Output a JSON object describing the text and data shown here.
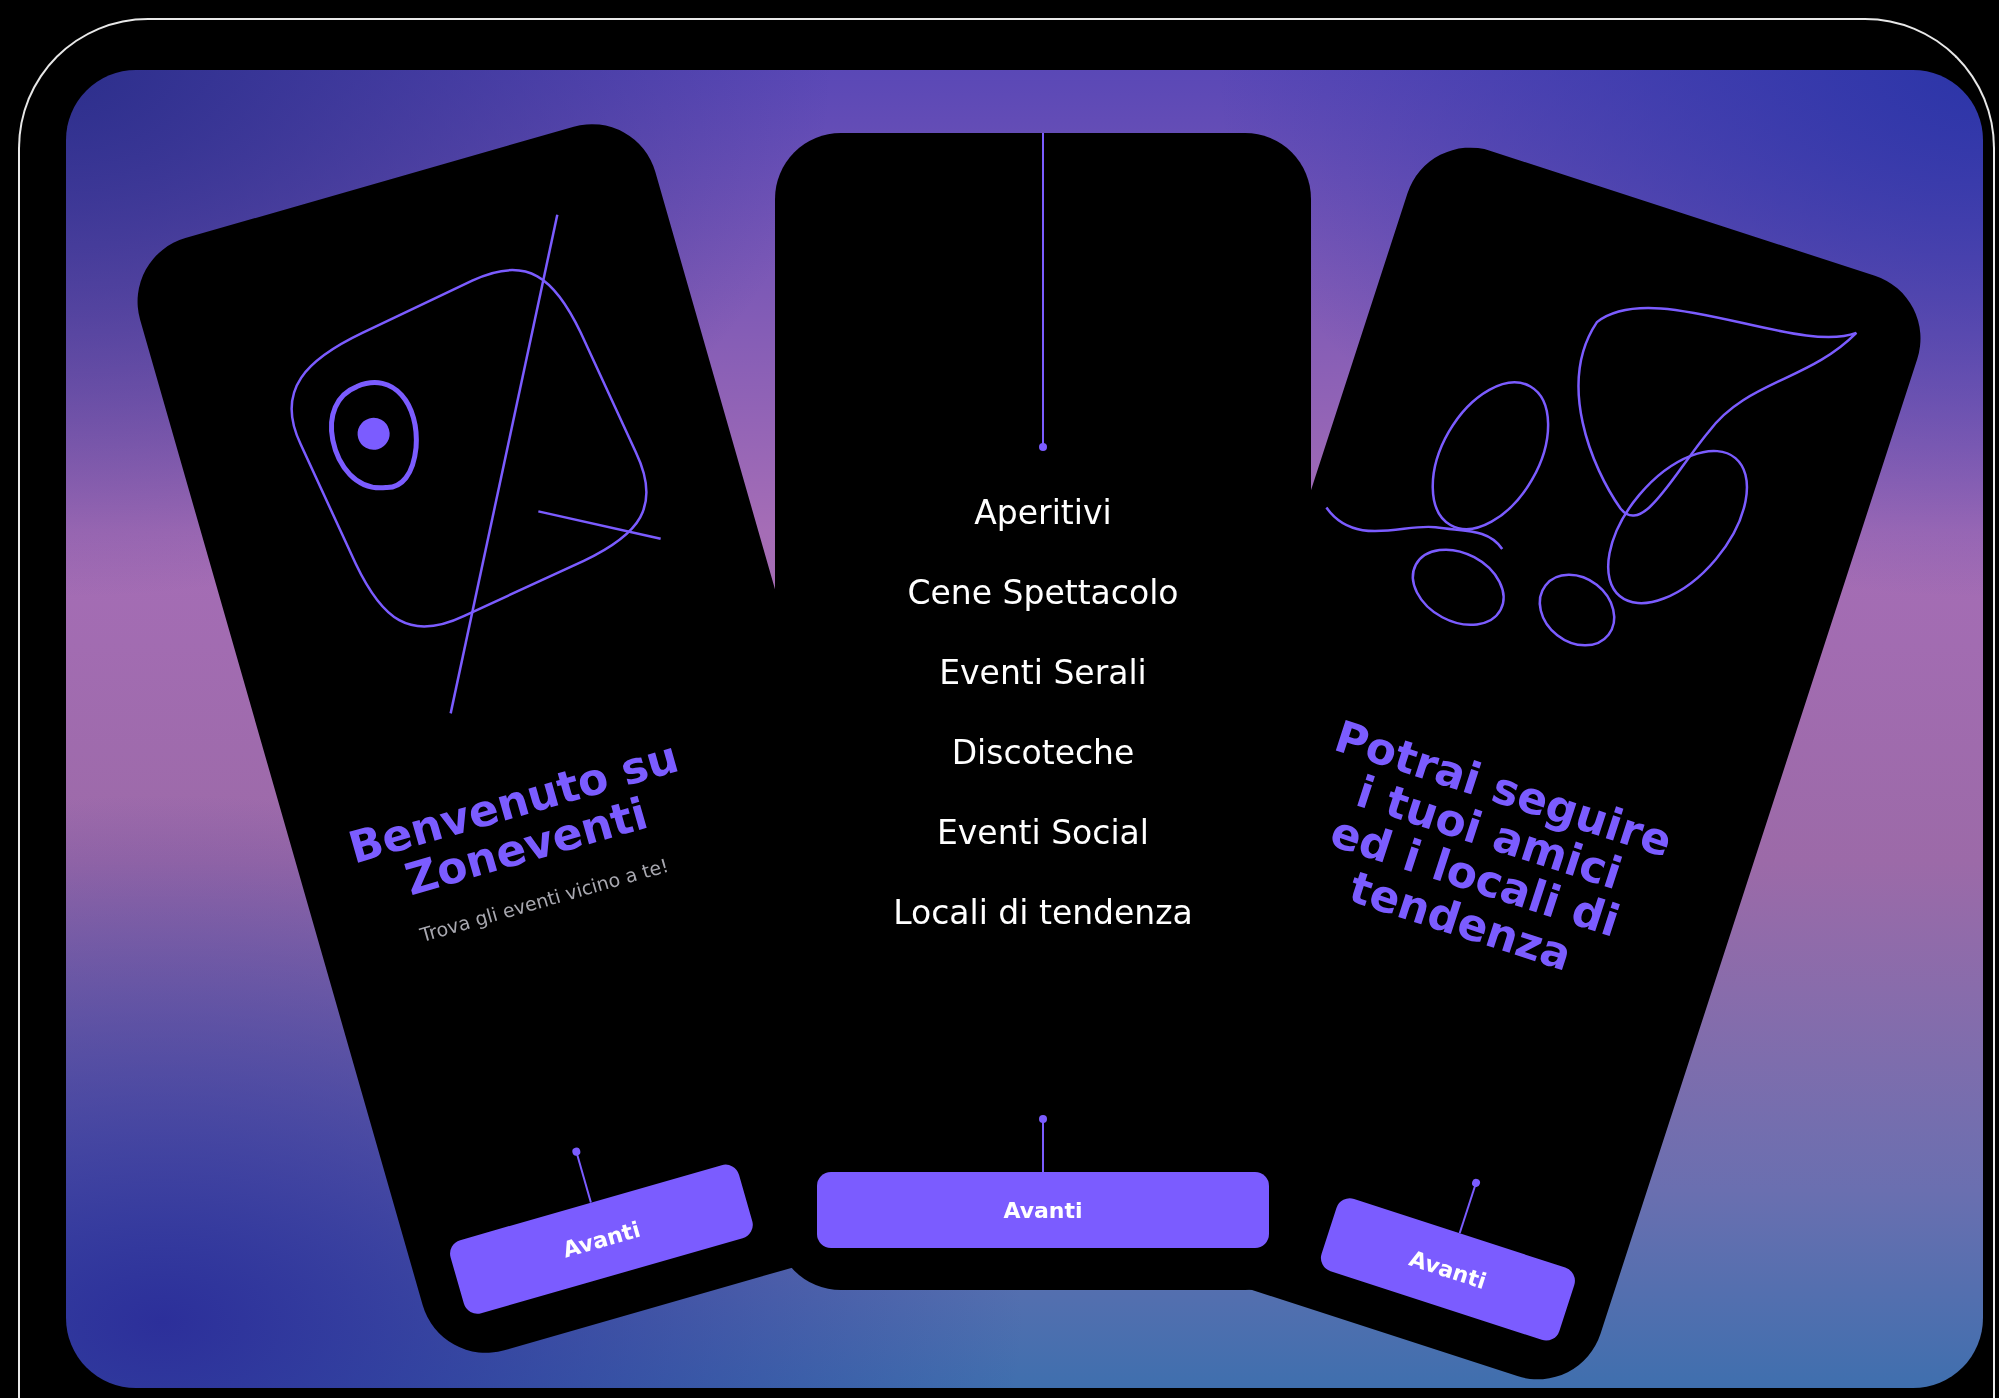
{
  "screens": [
    {
      "kind": "welcome",
      "title": "Benvenuto su\nZoneventi",
      "subtitle": "Trova gli eventi vicino a te!",
      "button": "Avanti"
    },
    {
      "kind": "list",
      "items": [
        "Aperitivi",
        "Cene Spettacolo",
        "Eventi Serali",
        "Discoteche",
        "Eventi Social",
        "Locali di tendenza"
      ],
      "button": "Avanti"
    },
    {
      "kind": "friends",
      "title": "Potrai seguire\ni tuoi amici\ned i locali di\ntendenza",
      "button": "Avanti"
    }
  ]
}
